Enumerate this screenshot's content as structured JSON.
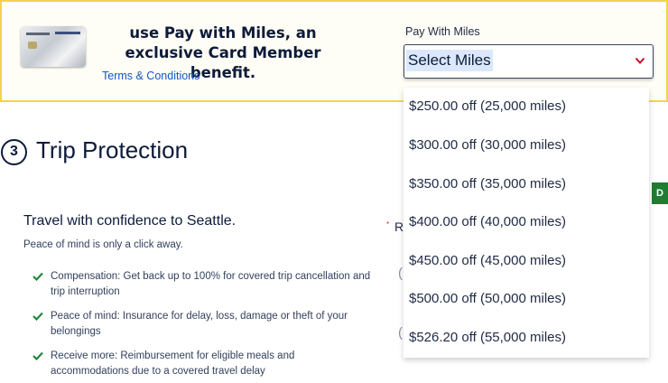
{
  "promo": {
    "line1": "use Pay with Miles, an",
    "line2": "exclusive Card Member benefit.",
    "terms_link": "Terms & Conditions",
    "card_image": "delta-skymiles-credit-card"
  },
  "pay_with_miles": {
    "label": "Pay With Miles",
    "selected_value": "Select Miles",
    "options": [
      "$250.00 off (25,000 miles)",
      "$300.00 off (30,000 miles)",
      "$350.00 off (35,000 miles)",
      "$400.00 off (40,000 miles)",
      "$450.00 off (45,000 miles)",
      "$500.00 off (50,000 miles)",
      "$526.20 off (55,000 miles)"
    ]
  },
  "trip_protection": {
    "step_number": "3",
    "title": "Trip Protection",
    "heading": "Travel with confidence to Seattle.",
    "subheading": "Peace of mind is only a click away.",
    "benefits": [
      "Compensation: Get back up to 100% for covered trip cancellation and trip interruption",
      "Peace of mind: Insurance for delay, loss, damage or theft of your belongings",
      "Receive more: Reimbursement for eligible meals and accommodations due to a covered travel delay"
    ],
    "required_marker": "*",
    "partial_label": "R",
    "partial_paren": "("
  },
  "side_tab": {
    "label": "D"
  },
  "colors": {
    "banner_border": "#f1d44e",
    "link_blue": "#1554c9",
    "check_green": "#1e8a3a",
    "chevron_red": "#c8102e",
    "navy": "#0d1b3a"
  }
}
